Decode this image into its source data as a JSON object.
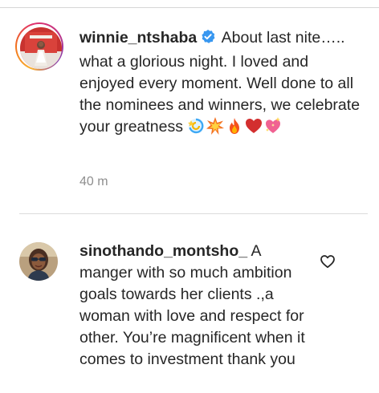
{
  "post": {
    "username": "winnie_ntshaba",
    "caption": "About last nite….. what a glorious night. I loved and enjoyed every moment. Well done to all the nominees and winners, we celebrate your greatness",
    "emojis": [
      "dizzy-emoji",
      "collision-emoji",
      "fire-emoji",
      "red-heart-emoji",
      "sparkling-heart-emoji"
    ],
    "timestamp": "40 m"
  },
  "comment": {
    "username": "sinothando_montsho_",
    "text": "A manger with so much ambition goals towards her clients .,a woman with love and respect for other. You’re magnificent when it comes to investment thank you"
  },
  "colors": {
    "verified": "#3897f0",
    "muted": "#8e8e8e",
    "text": "#262626"
  }
}
